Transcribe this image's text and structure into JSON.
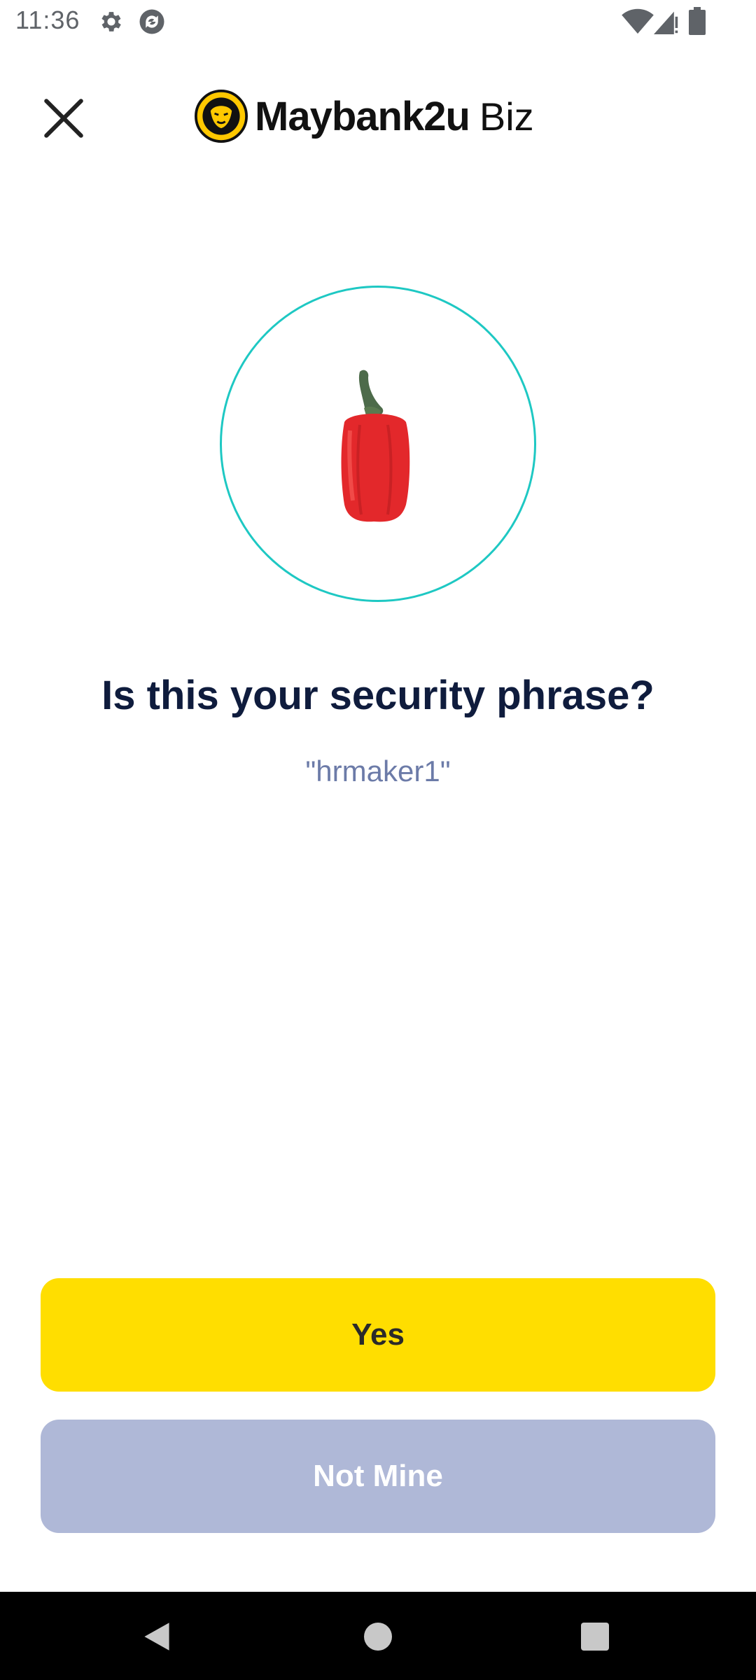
{
  "status_bar": {
    "time": "11:36",
    "icons": [
      "gear-icon",
      "sync-icon",
      "wifi-icon",
      "signal-icon",
      "battery-icon"
    ]
  },
  "header": {
    "close_icon": "close-icon",
    "logo_text": "Maybank2u",
    "logo_suffix": "Biz"
  },
  "security_image": {
    "icon": "red-bell-pepper",
    "ring_color": "#1ec8c3"
  },
  "main": {
    "question": "Is this your security phrase?",
    "phrase": "\"hrmaker1\""
  },
  "buttons": {
    "yes_label": "Yes",
    "not_mine_label": "Not Mine"
  },
  "colors": {
    "primary_yellow": "#ffde00",
    "disabled_blue": "#afb8d7",
    "title_navy": "#0f1c3d",
    "phrase_blue": "#6c7ba8"
  },
  "nav_bar": {
    "icons": [
      "back-icon",
      "home-icon",
      "recents-icon"
    ]
  }
}
